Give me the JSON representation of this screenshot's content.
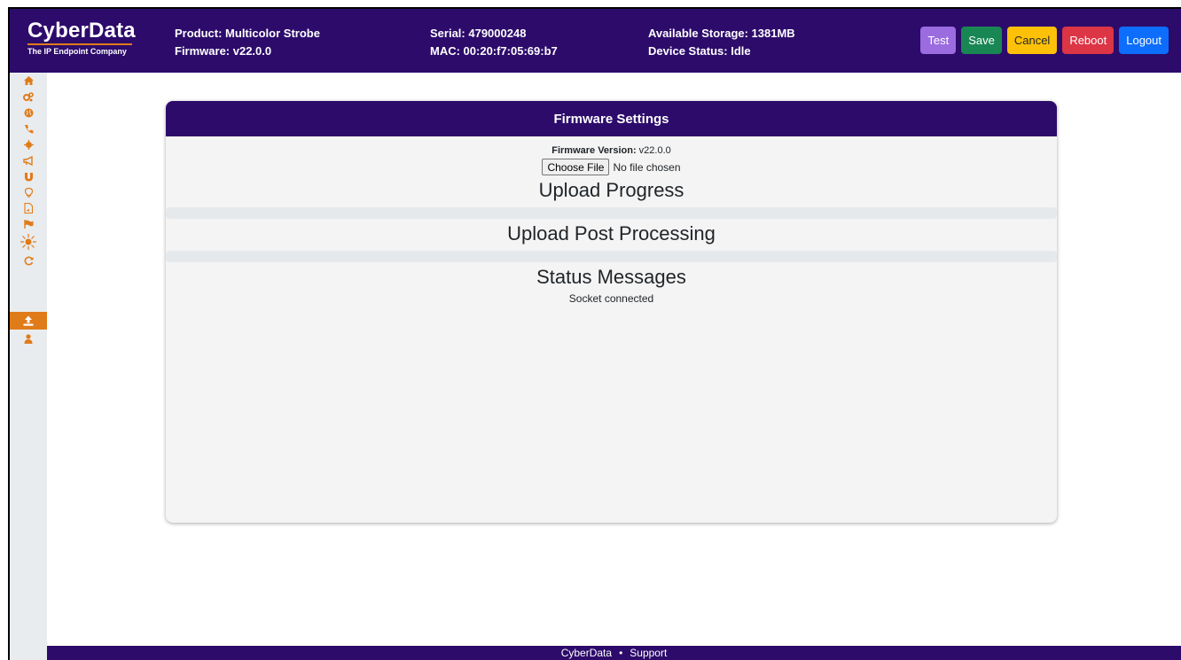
{
  "header": {
    "logo_title": "CyberData",
    "logo_subtitle": "The IP Endpoint Company",
    "product": "Product: Multicolor Strobe",
    "firmware": "Firmware: v22.0.0",
    "serial": "Serial: 479000248",
    "mac": "MAC: 00:20:f7:05:69:b7",
    "storage": "Available Storage: 1381MB",
    "device_status": "Device Status: Idle",
    "buttons": {
      "test": "Test",
      "save": "Save",
      "cancel": "Cancel",
      "reboot": "Reboot",
      "logout": "Logout"
    }
  },
  "sidebar": {
    "items": [
      {
        "icon": "home-icon"
      },
      {
        "icon": "gears-icon"
      },
      {
        "icon": "globe-icon"
      },
      {
        "icon": "phone-icon"
      },
      {
        "icon": "sun-icon"
      },
      {
        "icon": "megaphone-icon"
      },
      {
        "icon": "magnet-icon"
      },
      {
        "icon": "lightbulb-icon"
      },
      {
        "icon": "audio-file-icon"
      },
      {
        "icon": "flag-icon"
      },
      {
        "icon": "strobe-icon"
      },
      {
        "icon": "refresh-icon"
      },
      {
        "icon": "upload-icon",
        "active": true
      },
      {
        "icon": "user-icon"
      }
    ]
  },
  "card": {
    "title": "Firmware Settings",
    "fw_label": "Firmware Version:",
    "fw_value": "v22.0.0",
    "choose_file": "Choose File",
    "no_file": "No file chosen",
    "upload_progress": "Upload Progress",
    "upload_post": "Upload Post Processing",
    "status_messages": "Status Messages",
    "status_text": "Socket connected"
  },
  "footer": {
    "link1": "CyberData",
    "separator": "•",
    "link2": "Support"
  },
  "colors": {
    "brand_purple": "#2d0b6b",
    "accent_orange": "#e07b1a"
  }
}
